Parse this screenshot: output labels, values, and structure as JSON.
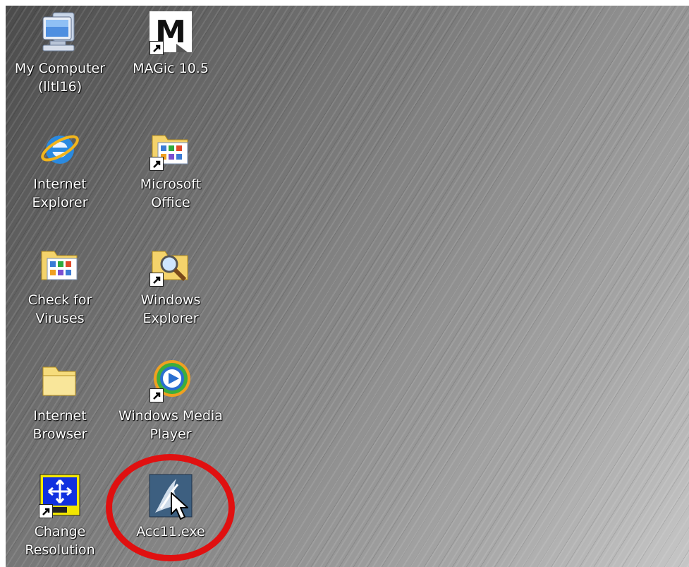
{
  "desktop": {
    "icons": [
      {
        "label": "My Computer\n(lltl16)",
        "icon": "my-computer-icon"
      },
      {
        "label": "MAGic 10.5",
        "icon": "magic-icon"
      },
      {
        "label": "Internet\nExplorer",
        "icon": "internet-explorer-icon"
      },
      {
        "label": "Microsoft\nOffice",
        "icon": "microsoft-office-folder-icon"
      },
      {
        "label": "Check for\nViruses",
        "icon": "check-viruses-folder-icon"
      },
      {
        "label": "Windows\nExplorer",
        "icon": "windows-explorer-icon"
      },
      {
        "label": "Internet\nBrowser",
        "icon": "folder-icon"
      },
      {
        "label": "Windows Media\nPlayer",
        "icon": "windows-media-player-icon"
      },
      {
        "label": "Change\nResolution",
        "icon": "change-resolution-icon"
      },
      {
        "label": "Acc11.exe",
        "icon": "acc11-icon"
      }
    ],
    "highlight_color": "#e01010"
  }
}
